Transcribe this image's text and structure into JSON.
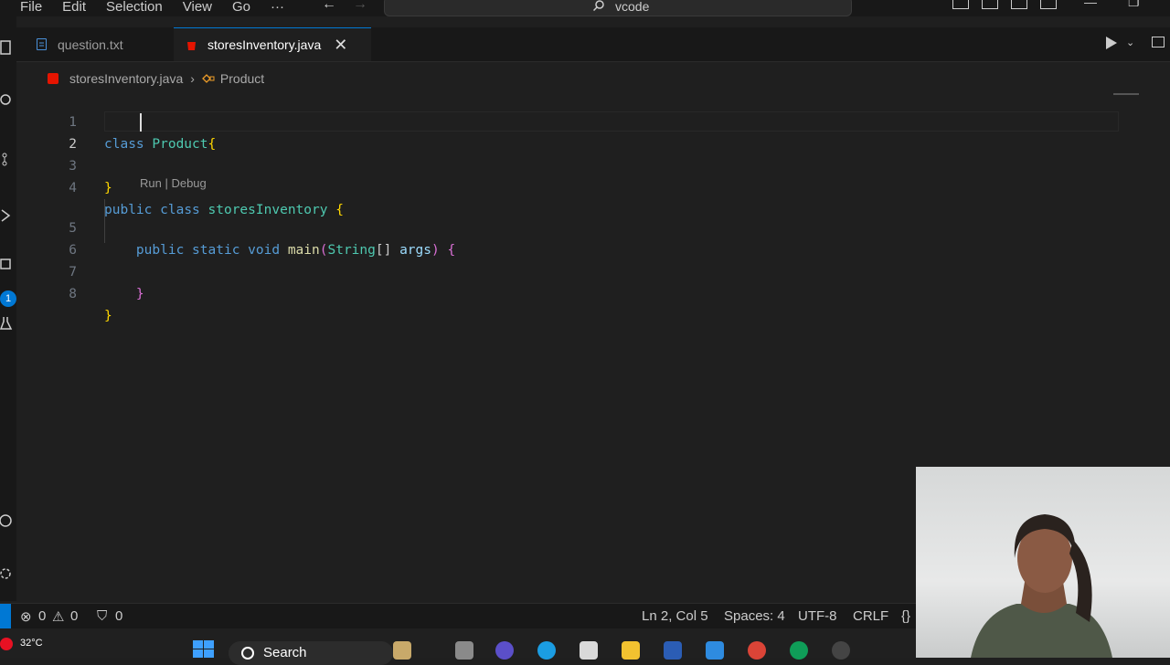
{
  "menu": [
    "File",
    "Edit",
    "Selection",
    "View",
    "Go",
    "···"
  ],
  "command_center": "vcode",
  "tabs": [
    {
      "label": "question.txt",
      "active": false
    },
    {
      "label": "storesInventory.java",
      "active": true
    }
  ],
  "close_glyph": "✕",
  "breadcrumb": {
    "file": "storesInventory.java",
    "symbol": "Product"
  },
  "line_numbers": [
    "1",
    "2",
    "3",
    "4",
    "5",
    "6",
    "7",
    "8"
  ],
  "code_lens": "Run | Debug",
  "status": {
    "errors": "0",
    "warnings": "0",
    "ports": "0",
    "position": "Ln 2, Col 5",
    "spaces": "Spaces: 4",
    "encoding": "UTF-8",
    "eol": "CRLF",
    "lang_icon": "{}"
  },
  "taskbar": {
    "weather": "32°C",
    "search": "Search"
  },
  "colors": {
    "accent": "#0078d4",
    "java_icon": "#e51400"
  }
}
